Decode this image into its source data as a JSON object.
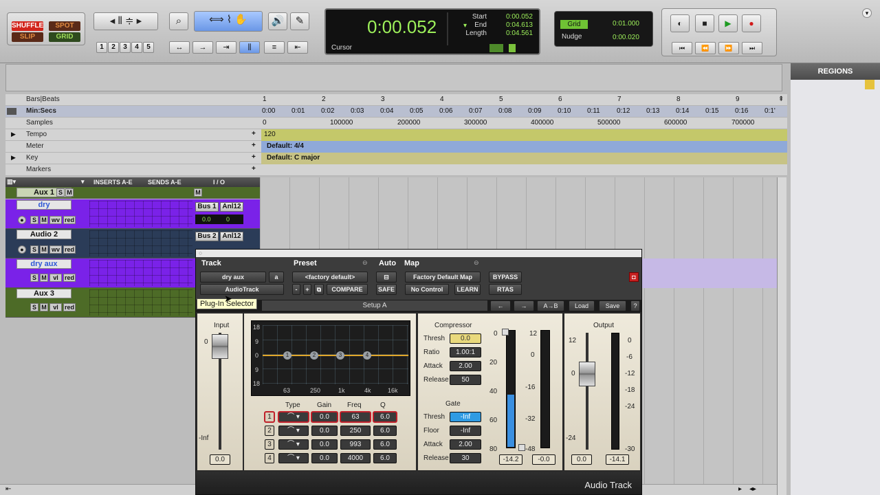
{
  "toolbar": {
    "modes": {
      "shuffle": "SHUFFLE",
      "spot": "SPOT",
      "slip": "SLIP",
      "grid": "GRID"
    },
    "zoom_presets": [
      "1",
      "2",
      "3",
      "4",
      "5"
    ],
    "counter": {
      "main": "0:00.052",
      "start_label": "Start",
      "end_label": "End",
      "length_label": "Length",
      "start": "0:00.052",
      "end": "0:04.613",
      "length": "0:04.561",
      "cursor_label": "Cursor"
    },
    "grid": {
      "label": "Grid",
      "value": "0:01.000",
      "nudge_label": "Nudge",
      "nudge_value": "0:00.020"
    }
  },
  "regions": {
    "title": "REGIONS"
  },
  "rulers": {
    "bars_label": "Bars|Beats",
    "bars": [
      "1",
      "2",
      "3",
      "4",
      "5",
      "6",
      "7",
      "8",
      "9"
    ],
    "minsecs_label": "Min:Secs",
    "minsecs": [
      "0:00",
      "0:01",
      "0:02",
      "0:03",
      "0:04",
      "0:05",
      "0:06",
      "0:07",
      "0:08",
      "0:09",
      "0:10",
      "0:11",
      "0:12",
      "0:13",
      "0:14",
      "0:15",
      "0:16",
      "0:1'"
    ],
    "samples_label": "Samples",
    "samples": [
      "0",
      "100000",
      "200000",
      "300000",
      "400000",
      "500000",
      "600000",
      "700000"
    ],
    "tempo_label": "Tempo",
    "tempo_value": "120",
    "meter_label": "Meter",
    "meter_value": "Default: 4/4",
    "key_label": "Key",
    "key_value": "Default: C major",
    "markers_label": "Markers"
  },
  "track_header": {
    "inserts": "INSERTS A-E",
    "sends": "SENDS A-E",
    "io": "I / O"
  },
  "tracks": [
    {
      "name": "Aux 1",
      "io_top": "",
      "io_bottom": ""
    },
    {
      "name": "dry",
      "io_top": "Bus 1",
      "io_sub": "Anl12",
      "vol": "0.0",
      "pan": "0"
    },
    {
      "name": "Audio 2",
      "io_top": "Bus 2",
      "io_sub": "Anl12"
    },
    {
      "name": "dry aux"
    },
    {
      "name": "Aux 3"
    }
  ],
  "track_buttons": {
    "s": "S",
    "m": "M",
    "wv": "wv",
    "vl": "vl",
    "red": "red",
    "rec": "●"
  },
  "plugin": {
    "headers": {
      "track": "Track",
      "preset": "Preset",
      "auto": "Auto",
      "map": "Map"
    },
    "track_name": "dry aux",
    "track_letter": "a",
    "insert": "AudioTrack",
    "preset_value": "<factory default>",
    "compare": "COMPARE",
    "safe": "SAFE",
    "map_value": "Factory Default Map",
    "no_control": "No Control",
    "learn": "LEARN",
    "bypass": "BYPASS",
    "rtas": "RTAS",
    "setup": "Setup A",
    "ab": "A→B",
    "load": "Load",
    "save": "Save",
    "help": "?",
    "footer": "Audio Track",
    "input": {
      "label": "Input",
      "top": "0",
      "bottom": "-Inf",
      "value": "0.0"
    },
    "eq": {
      "y_labels": [
        "18",
        "9",
        "0",
        "9",
        "18"
      ],
      "x_labels": [
        "63",
        "250",
        "1k",
        "4k",
        "16k"
      ],
      "points": [
        "1",
        "2",
        "3",
        "4"
      ],
      "columns": [
        "Type",
        "Gain",
        "Freq",
        "Q"
      ],
      "bands": [
        {
          "n": "1",
          "gain": "0.0",
          "freq": "63",
          "q": "6.0"
        },
        {
          "n": "2",
          "gain": "0.0",
          "freq": "250",
          "q": "6.0"
        },
        {
          "n": "3",
          "gain": "0.0",
          "freq": "993",
          "q": "6.0"
        },
        {
          "n": "4",
          "gain": "0.0",
          "freq": "4000",
          "q": "6.0"
        }
      ]
    },
    "compressor": {
      "title": "Compressor",
      "thresh_label": "Thresh",
      "thresh": "0.0",
      "ratio_label": "Ratio",
      "ratio": "1.00:1",
      "attack_label": "Attack",
      "attack": "2.00",
      "release_label": "Release",
      "release": "50"
    },
    "gate": {
      "title": "Gate",
      "thresh_label": "Thresh",
      "thresh": "-Inf",
      "floor_label": "Floor",
      "floor": "-Inf",
      "attack_label": "Attack",
      "attack": "2.00",
      "release_label": "Release",
      "release": "30"
    },
    "dyn_meter": {
      "left_scale": [
        "0",
        "20",
        "40",
        "60",
        "80"
      ],
      "right_scale": [
        "12",
        "0",
        "-16",
        "-32",
        "-48"
      ],
      "left_value": "-14.2",
      "right_value": "-0.0",
      "fill_level": 0.45
    },
    "output": {
      "label": "Output",
      "left_scale": [
        "12",
        "0",
        "-24"
      ],
      "right_scale": [
        "0",
        "-6",
        "-12",
        "-18",
        "-24",
        "-30"
      ],
      "value": "0.0",
      "meter_value": "-14.1"
    }
  },
  "tooltip": "Plug-In Selector",
  "colors": {
    "purple": "#7a22e8",
    "green_track": "#4d6b27",
    "ruler_yellow": "#c4c86a",
    "meter_blue": "#8fa9d9",
    "key_olive": "#c7c386"
  }
}
